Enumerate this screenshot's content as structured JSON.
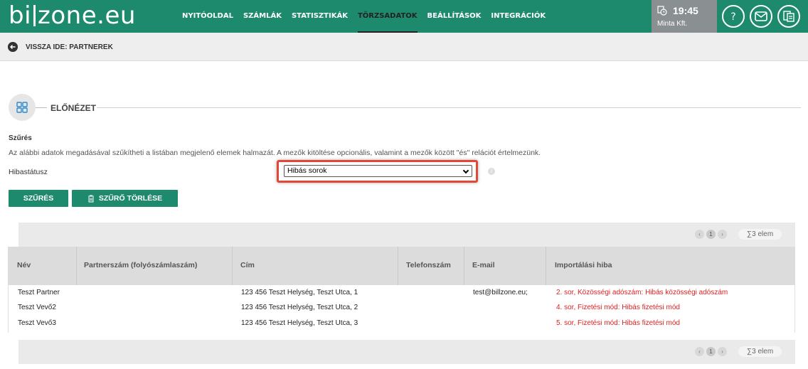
{
  "header": {
    "logo": "billzone.eu",
    "logo_left": "bi",
    "logo_right": "zone.eu",
    "nav": [
      "NYITÓOLDAL",
      "SZÁMLÁK",
      "STATISZTIKÁK",
      "TÖRZSADATOK",
      "BEÁLLÍTÁSOK",
      "INTEGRÁCIÓK"
    ],
    "active_nav": "TÖRZSADATOK",
    "time": "19:45",
    "company": "Minta Kft."
  },
  "back": {
    "label": "VISSZA IDE: PARTNEREK"
  },
  "section": {
    "title": "ELŐNÉZET"
  },
  "filter": {
    "title": "Szűrés",
    "description": "Az alábbi adatok megadásával szűkítheti a listában megjelenő elemek halmazát. A mezők kitöltése opcionális, valamint a mezők között \"és\" relációt értelmezünk.",
    "status_label": "Hibastátusz",
    "status_value": "Hibás sorok",
    "filter_button": "SZŰRÉS",
    "clear_button": "SZŰRŐ TÖRLÉSE"
  },
  "pagination": {
    "page": "1",
    "count": "3 elem"
  },
  "table": {
    "columns": [
      "Név",
      "Partnerszám (folyószámlaszám)",
      "Cím",
      "Telefonszám",
      "E-mail",
      "Importálási hiba"
    ],
    "rows": [
      {
        "name": "Teszt Partner",
        "partner_no": "",
        "address": "123 456 Teszt Helység, Teszt Utca, 1",
        "phone": "",
        "email": "test@billzone.eu;",
        "error": "2. sor, Közösségi adószám: Hibás közösségi adószám"
      },
      {
        "name": "Teszt Vevő2",
        "partner_no": "",
        "address": "123 456 Teszt Helység, Teszt Utca, 2",
        "phone": "",
        "email": "",
        "error": "4. sor, Fizetési mód: Hibás fizetési mód"
      },
      {
        "name": "Teszt Vevő3",
        "partner_no": "",
        "address": "123 456 Teszt Helység, Teszt Utca, 3",
        "phone": "",
        "email": "",
        "error": "5. sor, Fizetési mód: Hibás fizetési mód"
      }
    ]
  },
  "colors": {
    "brand": "#1d8a6d",
    "error": "#e02020",
    "highlight": "#e0493a"
  },
  "icons": [
    "clock-icon",
    "help-icon",
    "mail-icon",
    "documents-icon",
    "back-arrow-icon",
    "grid-icon",
    "info-icon",
    "trash-icon",
    "chevron-left-icon",
    "chevron-right-icon",
    "sum-icon"
  ]
}
